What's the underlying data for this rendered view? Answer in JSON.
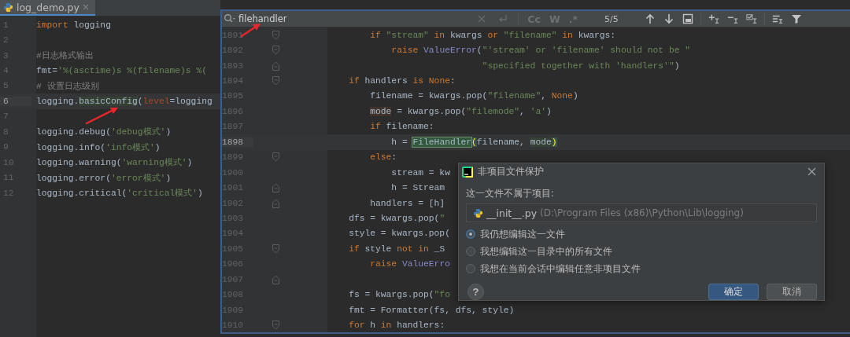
{
  "editor": {
    "tab": {
      "label": "log_demo.py",
      "selected": true
    },
    "lines": [
      {
        "number": "1",
        "current": false,
        "tokens": [
          {
            "kind": "kw",
            "text": "import"
          },
          {
            "kind": "plain",
            "text": " logging"
          }
        ]
      },
      {
        "number": "2",
        "current": false
      },
      {
        "number": "3",
        "current": false,
        "tokens": [
          {
            "kind": "comment",
            "text": "#日志格式输出"
          }
        ]
      },
      {
        "number": "4",
        "current": false,
        "tokens": [
          {
            "kind": "plain",
            "text": "fmt="
          },
          {
            "kind": "str",
            "text": "'%(asctime)s %(filename)s %("
          }
        ]
      },
      {
        "number": "5",
        "current": false,
        "tokens": [
          {
            "kind": "comment",
            "text": "# 设置日志级别"
          }
        ]
      },
      {
        "number": "6",
        "current": true,
        "tokens": [
          {
            "kind": "plain",
            "text": "logging."
          },
          {
            "kind": "usage",
            "text": "basicConfig"
          },
          {
            "kind": "plain",
            "text": "("
          },
          {
            "kind": "param",
            "text": "level"
          },
          {
            "kind": "plain",
            "text": "=logging"
          }
        ]
      },
      {
        "number": "7",
        "current": false
      },
      {
        "number": "8",
        "current": false,
        "tokens": [
          {
            "kind": "plain",
            "text": "logging.debug("
          },
          {
            "kind": "str",
            "text": "'debug模式'"
          },
          {
            "kind": "plain",
            "text": ")"
          }
        ]
      },
      {
        "number": "9",
        "current": false,
        "tokens": [
          {
            "kind": "plain",
            "text": "logging.info("
          },
          {
            "kind": "str",
            "text": "'info模式'"
          },
          {
            "kind": "plain",
            "text": ")"
          }
        ]
      },
      {
        "number": "10",
        "current": false,
        "tokens": [
          {
            "kind": "plain",
            "text": "logging.warning("
          },
          {
            "kind": "str",
            "text": "'warning模式'"
          },
          {
            "kind": "plain",
            "text": ")"
          }
        ]
      },
      {
        "number": "11",
        "current": false,
        "tokens": [
          {
            "kind": "plain",
            "text": "logging.error("
          },
          {
            "kind": "str",
            "text": "'error模式'"
          },
          {
            "kind": "plain",
            "text": ")"
          }
        ]
      },
      {
        "number": "12",
        "current": false,
        "tokens": [
          {
            "kind": "plain",
            "text": "logging.critical("
          },
          {
            "kind": "str",
            "text": "'critical模式'"
          },
          {
            "kind": "plain",
            "text": ")"
          }
        ]
      }
    ]
  },
  "source_view": {
    "search": {
      "query": "filehandler",
      "options": [
        {
          "label": "Cc",
          "on": false
        },
        {
          "label": "W",
          "on": false
        },
        {
          "label": ".*",
          "on": false
        }
      ],
      "match_count": "5/5"
    },
    "lines": [
      {
        "number": "1891",
        "current": false,
        "fold_start": true,
        "fold_end": false,
        "tokens": [
          {
            "kind": "kw",
            "text": "        if"
          },
          {
            "kind": "str",
            "text": " \"stream\""
          },
          {
            "kind": "kw",
            "text": " in"
          },
          {
            "kind": "plain",
            "text": " kwargs "
          },
          {
            "kind": "kw",
            "text": "or"
          },
          {
            "kind": "str",
            "text": " \"filename\""
          },
          {
            "kind": "kw",
            "text": " in"
          },
          {
            "kind": "plain",
            "text": " kwargs:"
          }
        ]
      },
      {
        "number": "1892",
        "current": false,
        "fold_start": true,
        "fold_end": false,
        "tokens": [
          {
            "kind": "kw",
            "text": "            raise"
          },
          {
            "kind": "builtin",
            "text": " ValueError"
          },
          {
            "kind": "plain",
            "text": "("
          },
          {
            "kind": "str",
            "text": "\"'stream' or 'filename' should not be \""
          }
        ]
      },
      {
        "number": "1893",
        "current": false,
        "fold_start": false,
        "fold_end": true,
        "tokens": [
          {
            "kind": "str",
            "text": "                             \"specified together with 'handlers'\""
          },
          {
            "kind": "plain",
            "text": ")"
          }
        ]
      },
      {
        "number": "1894",
        "current": false,
        "fold_start": true,
        "fold_end": false,
        "tokens": [
          {
            "kind": "kw",
            "text": "    if"
          },
          {
            "kind": "plain",
            "text": " handlers "
          },
          {
            "kind": "kw",
            "text": "is None"
          },
          {
            "kind": "plain",
            "text": ":"
          }
        ]
      },
      {
        "number": "1895",
        "current": false,
        "fold_start": false,
        "fold_end": false,
        "tokens": [
          {
            "kind": "plain",
            "text": "        filename = kwargs.pop("
          },
          {
            "kind": "str",
            "text": "\"filename\""
          },
          {
            "kind": "plain",
            "text": ", "
          },
          {
            "kind": "kw",
            "text": "None"
          },
          {
            "kind": "plain",
            "text": ")"
          }
        ]
      },
      {
        "number": "1896",
        "current": false,
        "fold_start": false,
        "fold_end": false,
        "tokens": [
          {
            "kind": "write",
            "text": "        mode"
          },
          {
            "kind": "plain",
            "text": " = kwargs.pop("
          },
          {
            "kind": "str",
            "text": "\"filemode\""
          },
          {
            "kind": "plain",
            "text": ", "
          },
          {
            "kind": "str",
            "text": "'a'"
          },
          {
            "kind": "plain",
            "text": ")"
          }
        ]
      },
      {
        "number": "1897",
        "current": false,
        "fold_start": false,
        "fold_end": false,
        "tokens": [
          {
            "kind": "kw",
            "text": "        if"
          },
          {
            "kind": "plain",
            "text": " filename:"
          }
        ]
      },
      {
        "number": "1898",
        "current": true,
        "fold_start": false,
        "fold_end": false,
        "tokens": [
          {
            "kind": "plain",
            "text": "            h = "
          },
          {
            "kind": "match",
            "text": "FileHandler"
          },
          {
            "kind": "brace",
            "text": "("
          },
          {
            "kind": "plain",
            "text": "filename, "
          },
          {
            "kind": "usage",
            "text": "mode"
          },
          {
            "kind": "brace",
            "text": ")"
          }
        ]
      },
      {
        "number": "1899",
        "current": false,
        "fold_start": true,
        "fold_end": false,
        "tokens": [
          {
            "kind": "kw",
            "text": "        else"
          },
          {
            "kind": "plain",
            "text": ":"
          }
        ]
      },
      {
        "number": "1900",
        "current": false,
        "fold_start": false,
        "fold_end": false,
        "tokens": [
          {
            "kind": "plain",
            "text": "            stream = kw"
          }
        ]
      },
      {
        "number": "1901",
        "current": false,
        "fold_start": false,
        "fold_end": true,
        "tokens": [
          {
            "kind": "plain",
            "text": "            h = Stream"
          }
        ]
      },
      {
        "number": "1902",
        "current": false,
        "fold_start": false,
        "fold_end": true,
        "tokens": [
          {
            "kind": "plain",
            "text": "        handlers = [h]"
          }
        ]
      },
      {
        "number": "1903",
        "current": false,
        "fold_start": false,
        "fold_end": false,
        "tokens": [
          {
            "kind": "plain",
            "text": "    dfs = kwargs.pop("
          },
          {
            "kind": "str",
            "text": "\""
          }
        ]
      },
      {
        "number": "1904",
        "current": false,
        "fold_start": false,
        "fold_end": false,
        "tokens": [
          {
            "kind": "plain",
            "text": "    style = kwargs.pop("
          }
        ]
      },
      {
        "number": "1905",
        "current": false,
        "fold_start": true,
        "fold_end": false,
        "tokens": [
          {
            "kind": "kw",
            "text": "    if"
          },
          {
            "kind": "plain",
            "text": " style "
          },
          {
            "kind": "kw",
            "text": "not in"
          },
          {
            "kind": "plain",
            "text": " _S"
          }
        ]
      },
      {
        "number": "1906",
        "current": false,
        "fold_start": false,
        "fold_end": false,
        "tokens": [
          {
            "kind": "kw",
            "text": "        raise"
          },
          {
            "kind": "builtin",
            "text": " ValueErro"
          }
        ]
      },
      {
        "number": "1907",
        "current": false,
        "fold_start": false,
        "fold_end": true
      },
      {
        "number": "1908",
        "current": false,
        "fold_start": false,
        "fold_end": false,
        "tokens": [
          {
            "kind": "plain",
            "text": "    fs = kwargs.pop("
          },
          {
            "kind": "str",
            "text": "\"fo"
          }
        ]
      },
      {
        "number": "1909",
        "current": false,
        "fold_start": false,
        "fold_end": false,
        "tokens": [
          {
            "kind": "plain",
            "text": "    fmt = Formatter(fs, dfs, style)"
          }
        ]
      },
      {
        "number": "1910",
        "current": false,
        "fold_start": true,
        "fold_end": false,
        "tokens": [
          {
            "kind": "kw",
            "text": "    for"
          },
          {
            "kind": "plain",
            "text": " h "
          },
          {
            "kind": "kw",
            "text": "in"
          },
          {
            "kind": "plain",
            "text": " handlers:"
          }
        ]
      }
    ]
  },
  "dialog": {
    "title": "非项目文件保护",
    "message": "这一文件不属于项目:",
    "file": {
      "name": "__init__.py",
      "path": "(D:\\Program Files (x86)\\Python\\Lib\\logging)"
    },
    "options": [
      {
        "label": "我仍想编辑这一文件",
        "selected": true
      },
      {
        "label": "我想编辑这一目录中的所有文件",
        "selected": false
      },
      {
        "label": "我想在当前会话中编辑任意非项目文件",
        "selected": false
      }
    ],
    "help": "?",
    "buttons": [
      {
        "label": "确定",
        "kind": "primary"
      },
      {
        "label": "取消",
        "kind": "secondary"
      }
    ]
  }
}
